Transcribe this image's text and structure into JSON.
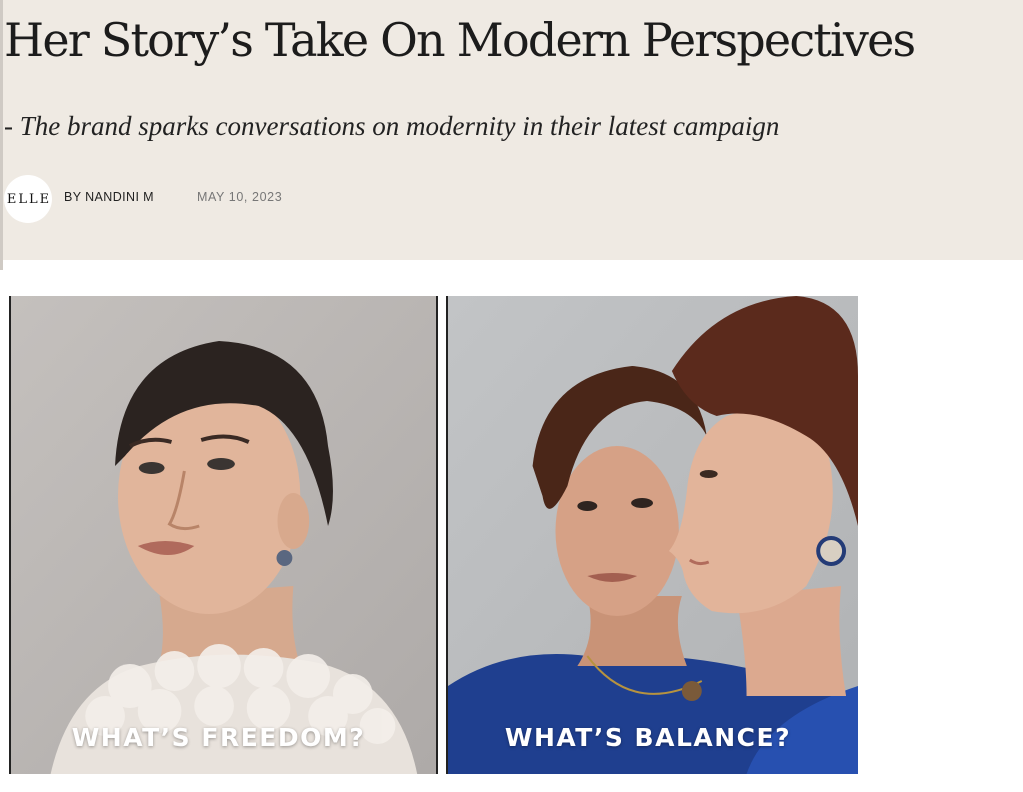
{
  "article": {
    "title": "Her Story’s Take On Modern Perspectives",
    "subtitle": "- The brand sparks conversations on modernity in their latest campaign",
    "brand_logo_text": "ELLE",
    "byline": "BY NANDINI M",
    "date": "MAY 10, 2023"
  },
  "images": [
    {
      "caption": "WHAT’S FREEDOM?",
      "subject": "portrait-woman-white-ruffled-top"
    },
    {
      "caption": "WHAT’S BALANCE?",
      "subject": "portrait-two-women-blue-dresses"
    }
  ],
  "colors": {
    "hero_background": "#efeae3",
    "title_text": "#1c1c1c",
    "date_text": "#777777",
    "caption_text": "#ffffff"
  }
}
